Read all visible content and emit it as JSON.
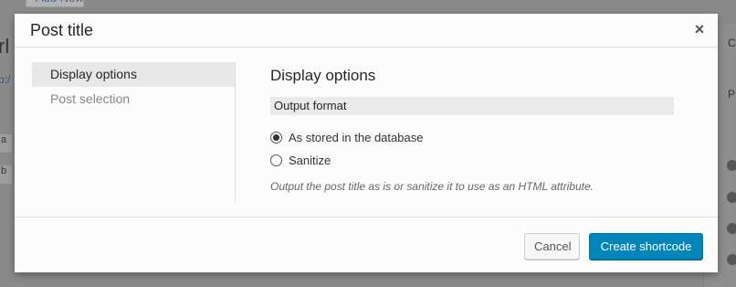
{
  "background": {
    "top_button_label": "Add New",
    "heading_fragment": "rl",
    "link_fragment": "p:/",
    "chip_a": "a",
    "chip_b": "b",
    "right_text_1": "C",
    "right_text_2": "P"
  },
  "modal": {
    "title": "Post title",
    "close_label": "×",
    "sidebar": {
      "items": [
        {
          "label": "Display options",
          "active": true
        },
        {
          "label": "Post selection",
          "active": false
        }
      ]
    },
    "content": {
      "section_title": "Display options",
      "group_label": "Output format",
      "options": [
        {
          "label": "As stored in the database",
          "checked": true
        },
        {
          "label": "Sanitize",
          "checked": false
        }
      ],
      "help_text": "Output the post title as is or sanitize it to use as an HTML attribute."
    },
    "footer": {
      "cancel_label": "Cancel",
      "create_label": "Create shortcode"
    }
  },
  "colors": {
    "primary": "#0085ba",
    "overlay": "#8a8a8a",
    "modal_bg": "#fcfcfc"
  }
}
